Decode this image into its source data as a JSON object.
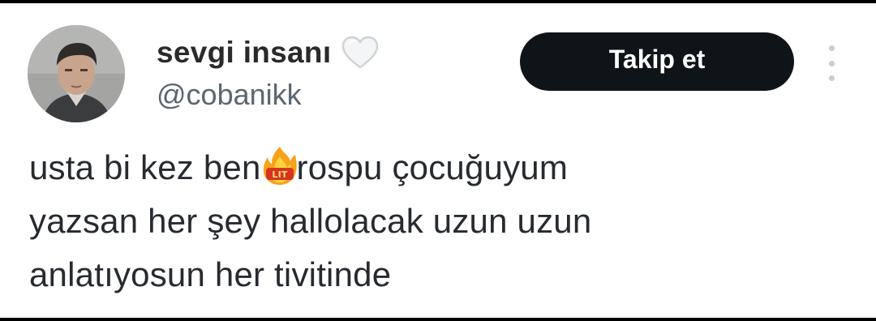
{
  "profile": {
    "display_name": "sevgi insanı",
    "name_icon": "white-heart-icon",
    "handle": "@cobanikk",
    "avatar_icon": "avatar"
  },
  "actions": {
    "follow_label": "Takip et",
    "more_icon": "more-options-icon"
  },
  "tweet": {
    "line1_a": "usta bi kez ben",
    "emoji": "lit-fire-emoji",
    "emoji_text": "LIT",
    "line1_b": "rospu çocuğuyum",
    "line2": "yazsan her şey hallolacak uzun uzun",
    "line3": "anlatıyosun her tivitinde"
  },
  "colors": {
    "button_bg": "#0f1419",
    "handle": "#5b6670",
    "text": "#272b30"
  }
}
